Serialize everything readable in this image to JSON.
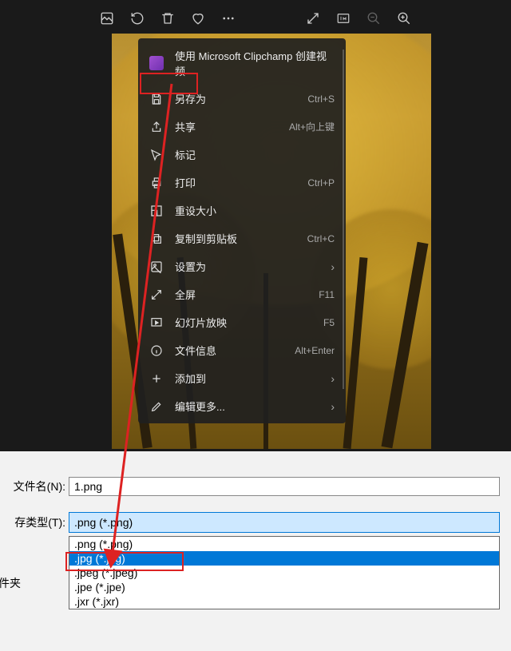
{
  "toolbar": {
    "icons": [
      "edit-icon",
      "rotate-icon",
      "delete-icon",
      "favorite-icon",
      "more-icon",
      "expand-icon",
      "fit-icon",
      "zoom-out-icon",
      "zoom-in-icon"
    ]
  },
  "context_menu": {
    "clipchamp_label": "使用 Microsoft Clipchamp 创建视频",
    "items": [
      {
        "icon": "save-icon",
        "label": "另存为",
        "shortcut": "Ctrl+S"
      },
      {
        "icon": "share-icon",
        "label": "共享",
        "shortcut": "Alt+向上键"
      },
      {
        "icon": "tag-icon",
        "label": "标记",
        "shortcut": ""
      },
      {
        "icon": "print-icon",
        "label": "打印",
        "shortcut": "Ctrl+P"
      },
      {
        "icon": "resize-icon",
        "label": "重设大小",
        "shortcut": ""
      },
      {
        "icon": "copy-icon",
        "label": "复制到剪贴板",
        "shortcut": "Ctrl+C"
      },
      {
        "icon": "wallpaper-icon",
        "label": "设置为",
        "shortcut": "",
        "submenu": true
      },
      {
        "icon": "fullscreen-icon",
        "label": "全屏",
        "shortcut": "F11"
      },
      {
        "icon": "slideshow-icon",
        "label": "幻灯片放映",
        "shortcut": "F5"
      },
      {
        "icon": "info-icon",
        "label": "文件信息",
        "shortcut": "Alt+Enter"
      },
      {
        "icon": "add-icon",
        "label": "添加到",
        "shortcut": "",
        "submenu": true
      },
      {
        "icon": "edit-more-icon",
        "label": "编辑更多...",
        "shortcut": "",
        "submenu": true
      }
    ]
  },
  "save_dialog": {
    "filename_label": "文件名(N):",
    "filename_value": "1.png",
    "filetype_label": "存类型(T):",
    "filetype_value": ".png (*.png)",
    "folder_label": "件夹",
    "options": [
      ".png (*.png)",
      ".jpg (*.jpg)",
      ".jpeg (*.jpeg)",
      ".jpe (*.jpe)",
      ".jxr (*.jxr)"
    ]
  }
}
